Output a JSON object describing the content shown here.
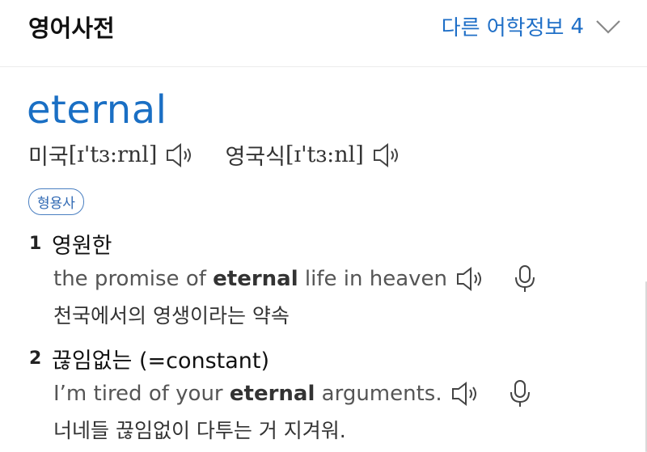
{
  "header": {
    "title": "영어사전",
    "more_label": "다른 어학정보",
    "more_count": "4"
  },
  "entry": {
    "word": "eternal",
    "pronunciations": [
      {
        "label": "미국",
        "ipa": "[ɪ'tɜ:rnl]"
      },
      {
        "label": "영국식",
        "ipa": "[ɪ'tɜ:nl]"
      }
    ],
    "part_of_speech": "형용사",
    "senses": [
      {
        "number": "1",
        "meaning": "영원한",
        "example_before": "the promise of ",
        "example_bold": "eternal",
        "example_after": " life in heaven",
        "translation": "천국에서의 영생이라는 약속"
      },
      {
        "number": "2",
        "meaning": "끊임없는 (=constant)",
        "example_before": "I’m tired of your ",
        "example_bold": "eternal",
        "example_after": " arguments.",
        "translation": "너네들 끊임없이 다투는 거 지겨워."
      }
    ]
  },
  "icons": {
    "speaker": "speaker-icon",
    "mic": "microphone-icon",
    "chevron": "chevron-down-icon"
  },
  "colors": {
    "accent": "#1a6fc4",
    "badge_border": "#4a7fc1"
  }
}
